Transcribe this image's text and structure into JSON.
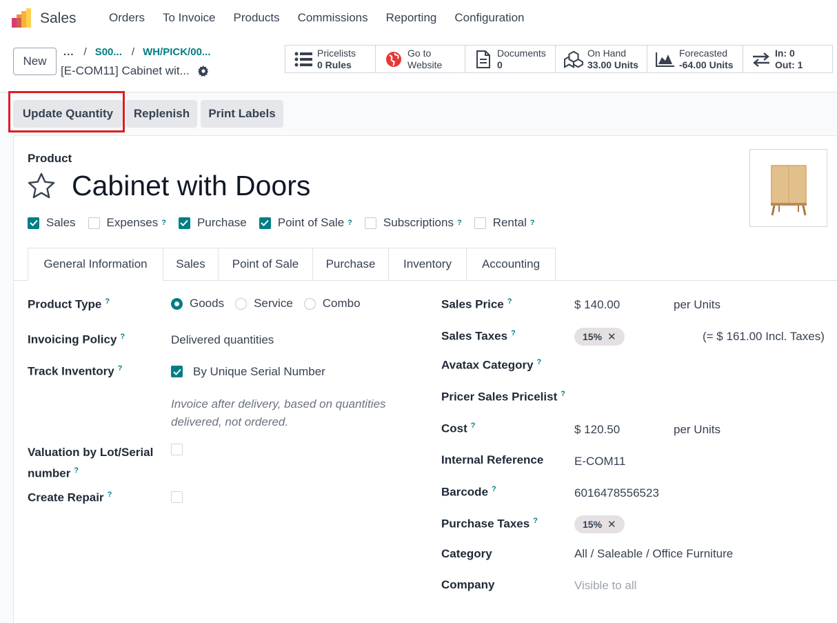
{
  "navbar": {
    "app_name": "Sales",
    "menu": [
      "Orders",
      "To Invoice",
      "Products",
      "Commissions",
      "Reporting",
      "Configuration"
    ]
  },
  "control": {
    "new_label": "New",
    "breadcrumb": {
      "more": "...",
      "items": [
        "S00...",
        "WH/PICK/00..."
      ],
      "separator": "/"
    },
    "record_title": "[E-COM11] Cabinet wit..."
  },
  "smart_buttons": [
    {
      "icon": "list-icon",
      "line1": "Pricelists",
      "line2": "0 Rules"
    },
    {
      "icon": "globe-icon",
      "line1": "Go to",
      "line2": "Website"
    },
    {
      "icon": "document-icon",
      "line1": "Documents",
      "line2": "0"
    },
    {
      "icon": "cubes-icon",
      "line1": "On Hand",
      "line2": "33.00 Units"
    },
    {
      "icon": "area-chart-icon",
      "line1": "Forecasted",
      "line2": "-64.00 Units"
    },
    {
      "icon": "exchange-icon",
      "line1": "In: 0",
      "line2": "Out: 1"
    }
  ],
  "actions": [
    "Update Quantity",
    "Replenish",
    "Print Labels"
  ],
  "product": {
    "label": "Product",
    "name": "Cabinet with Doors",
    "checkboxes": [
      {
        "label": "Sales",
        "checked": true,
        "help": false
      },
      {
        "label": "Expenses",
        "checked": false,
        "help": true
      },
      {
        "label": "Purchase",
        "checked": true,
        "help": false
      },
      {
        "label": "Point of Sale",
        "checked": true,
        "help": true
      },
      {
        "label": "Subscriptions",
        "checked": false,
        "help": true
      },
      {
        "label": "Rental",
        "checked": false,
        "help": true
      }
    ]
  },
  "tabs": [
    "General Information",
    "Sales",
    "Point of Sale",
    "Purchase",
    "Inventory",
    "Accounting"
  ],
  "help_mark": "?",
  "left": {
    "product_type_label": "Product Type",
    "product_type_options": [
      "Goods",
      "Service",
      "Combo"
    ],
    "product_type_selected": "Goods",
    "invoicing_policy_label": "Invoicing Policy",
    "invoicing_policy_value": "Delivered quantities",
    "track_inventory_label": "Track Inventory",
    "track_inventory_value": "By Unique Serial Number",
    "invoice_note": "Invoice after delivery, based on quantities delivered, not ordered.",
    "valuation_label_1": "Valuation by Lot/Serial",
    "valuation_label_2": "number",
    "create_repair_label": "Create Repair"
  },
  "right": {
    "sales_price_label": "Sales Price",
    "sales_price_value": "$ 140.00",
    "sales_price_uom": "per Units",
    "sales_taxes_label": "Sales Taxes",
    "sales_taxes_tag": "15%",
    "sales_taxes_incl": "(= $ 161.00 Incl. Taxes)",
    "avatax_label": "Avatax Category",
    "pricer_label": "Pricer Sales Pricelist",
    "cost_label": "Cost",
    "cost_value": "$ 120.50",
    "cost_uom": "per Units",
    "internal_ref_label": "Internal Reference",
    "internal_ref_value": "E-COM11",
    "barcode_label": "Barcode",
    "barcode_value": "6016478556523",
    "purchase_taxes_label": "Purchase Taxes",
    "purchase_taxes_tag": "15%",
    "category_label": "Category",
    "category_value": "All / Saleable / Office Furniture",
    "company_label": "Company",
    "company_value": "Visible to all"
  },
  "colors": {
    "accent": "#017e84",
    "highlight": "#e01b24",
    "brand": "#714b67"
  }
}
